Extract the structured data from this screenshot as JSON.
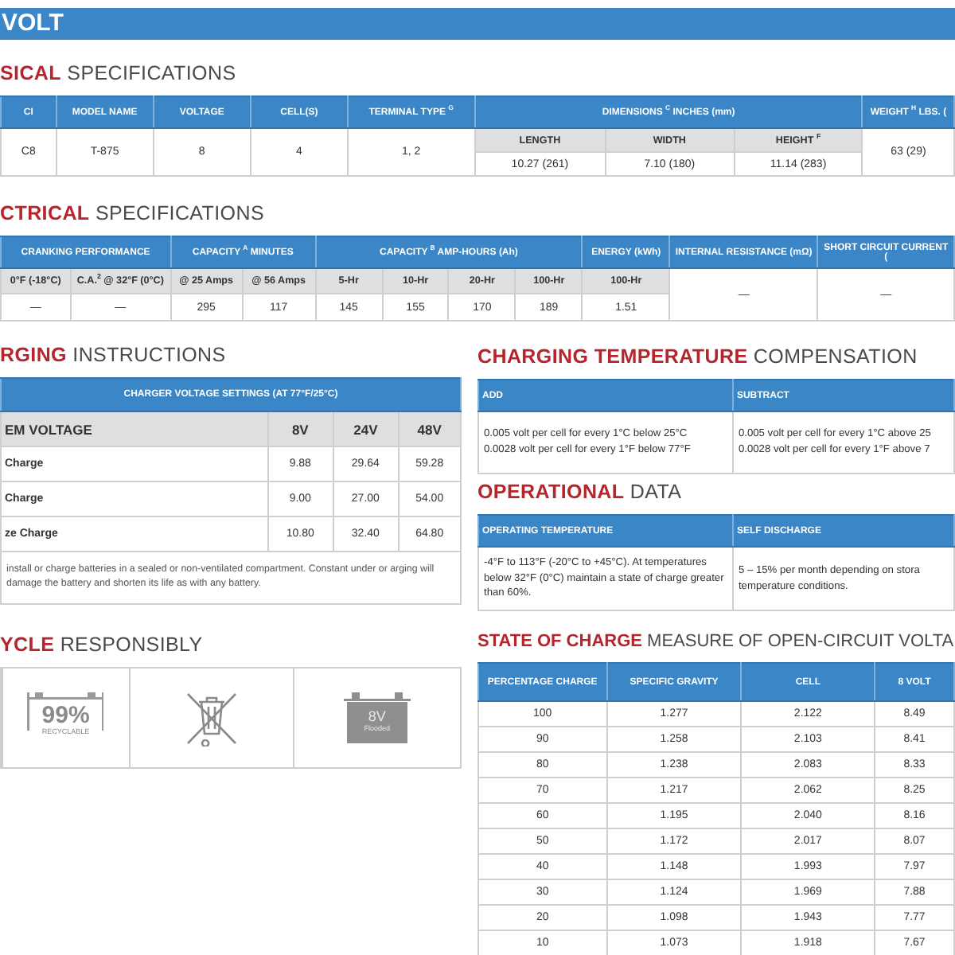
{
  "banner": {
    "title": "VOLT"
  },
  "physical": {
    "title": "**SICAL** SPECIFICATIONS",
    "columns": [
      "CI",
      "MODEL NAME",
      "VOLTAGE",
      "CELL(S)",
      "TERMINAL TYPE $^{G}$",
      "DIMENSIONS $^{C}$ INCHES (mm)",
      "WEIGHT $^{H}$ LBS. ("
    ],
    "dimension_columns": [
      "LENGTH",
      "WIDTH",
      "HEIGHT $^{F}$"
    ],
    "row": [
      "C8",
      "T-875",
      "8",
      "4",
      "1, 2",
      "10.27 (261)",
      "7.10 (180)",
      "11.14 (283)",
      "63 (29)"
    ]
  },
  "electrical": {
    "title": "**CTRICAL** SPECIFICATIONS",
    "columns": [
      "CRANKING PERFORMANCE",
      "CAPACITY $^{A}$ MINUTES",
      "CAPACITY $^{B}$ AMP-HOURS (Ah)",
      "ENERGY (kWh)",
      "INTERNAL RESISTANCE (mΩ)",
      "SHORT CIRCUIT CURRENT ("
    ],
    "subcolumns": [
      "0°F (-18°C)",
      "C.A.$^{2}$ @ 32°F (0°C)",
      "@ 25 Amps",
      "@ 56 Amps",
      "5-Hr",
      "10-Hr",
      "20-Hr",
      "100-Hr",
      "100-Hr"
    ],
    "row": [
      "—",
      "—",
      "295",
      "117",
      "145",
      "155",
      "170",
      "189",
      "1.51",
      "—",
      "—"
    ]
  },
  "charging": {
    "title": "**RGING** INSTRUCTIONS",
    "caption": "CHARGER VOLTAGE SETTINGS (AT 77°F/25°C)",
    "columns": [
      "EM VOLTAGE",
      "8V",
      "24V",
      "48V"
    ],
    "rows": [
      [
        "Charge",
        "9.88",
        "29.64",
        "59.28"
      ],
      [
        "Charge",
        "9.00",
        "27.00",
        "54.00"
      ],
      [
        "ze Charge",
        "10.80",
        "32.40",
        "64.80"
      ]
    ],
    "note": "install or charge batteries in a sealed or non-ventilated compartment. Constant under or arging will damage the battery and shorten its life as with any battery."
  },
  "recycle": {
    "title": "**YCLE** RESPONSIBLY",
    "badges": [
      {
        "kind": "recyclable",
        "value": "99%",
        "label": "RECYCLABLE"
      },
      {
        "kind": "bin"
      },
      {
        "kind": "battery",
        "value": "8V",
        "label": "Flooded"
      }
    ]
  },
  "compensation": {
    "title": "**CHARGING TEMPERATURE** COMPENSATION",
    "columns": [
      "ADD",
      "SUBTRACT"
    ],
    "cells": [
      [
        "0.005 volt per cell for every 1°C below 25°C",
        "0.0028 volt per cell for every 1°F below 77°F"
      ],
      [
        "0.005 volt per cell for every 1°C above 25",
        "0.0028 volt per cell for every 1°F above 7"
      ]
    ]
  },
  "operational": {
    "title": "**OPERATIONAL** DATA",
    "columns": [
      "OPERATING TEMPERATURE",
      "SELF DISCHARGE"
    ],
    "cells": [
      "-4°F to 113°F (-20°C to +45°C). At temperatures below 32°F (0°C) maintain a state of charge greater than 60%.",
      "5 – 15% per month depending on stora temperature conditions."
    ]
  },
  "state_of_charge": {
    "title": "**STATE OF CHARGE** MEASURE OF OPEN-CIRCUIT VOLTA",
    "columns": [
      "PERCENTAGE CHARGE",
      "SPECIFIC GRAVITY",
      "CELL",
      "8 VOLT"
    ],
    "rows": [
      [
        "100",
        "1.277",
        "2.122",
        "8.49"
      ],
      [
        "90",
        "1.258",
        "2.103",
        "8.41"
      ],
      [
        "80",
        "1.238",
        "2.083",
        "8.33"
      ],
      [
        "70",
        "1.217",
        "2.062",
        "8.25"
      ],
      [
        "60",
        "1.195",
        "2.040",
        "8.16"
      ],
      [
        "50",
        "1.172",
        "2.017",
        "8.07"
      ],
      [
        "40",
        "1.148",
        "1.993",
        "7.97"
      ],
      [
        "30",
        "1.124",
        "1.969",
        "7.88"
      ],
      [
        "20",
        "1.098",
        "1.943",
        "7.77"
      ],
      [
        "10",
        "1.073",
        "1.918",
        "7.67"
      ]
    ]
  }
}
